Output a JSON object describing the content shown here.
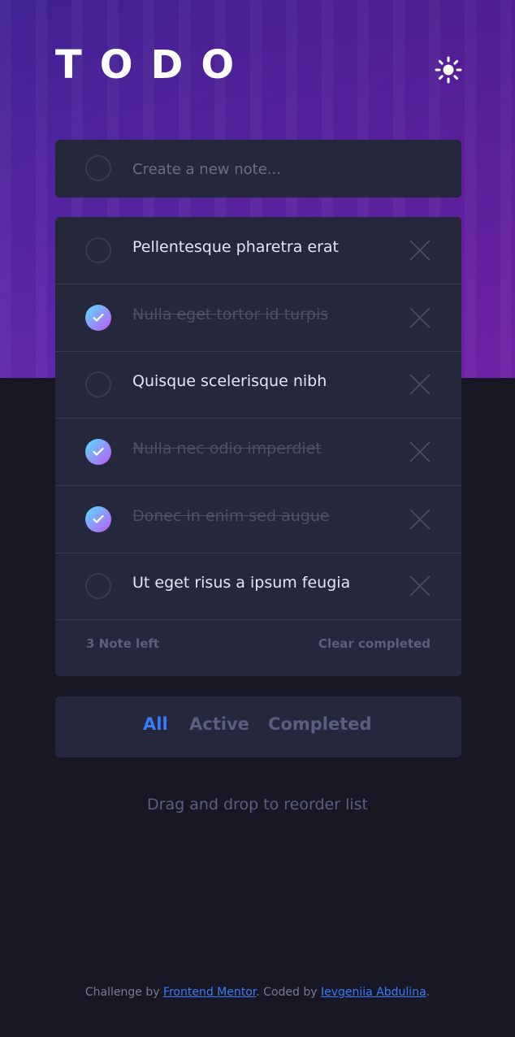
{
  "header": {
    "title": "TODO",
    "theme_icon": "sun-icon"
  },
  "new_note": {
    "placeholder": "Create a new note..."
  },
  "todos": [
    {
      "text": "Pellentesque pharetra erat",
      "completed": false
    },
    {
      "text": "Nulla eget tortor id turpis",
      "completed": true
    },
    {
      "text": "Quisque scelerisque nibh",
      "completed": false
    },
    {
      "text": "Nulla nec odio imperdiet",
      "completed": true
    },
    {
      "text": "Donec in enim sed augue",
      "completed": true
    },
    {
      "text": "Ut eget risus a ipsum feugia",
      "completed": false
    }
  ],
  "list_footer": {
    "items_left": "3 Note left",
    "clear_label": "Clear completed"
  },
  "filters": {
    "all": "All",
    "active": "Active",
    "completed": "Completed",
    "selected": "All"
  },
  "hint": "Drag and drop to reorder list",
  "attribution": {
    "prefix": "Challenge by ",
    "link1": "Frontend Mentor",
    "middle": ". Coded by ",
    "link2": "Ievgeniia Abdulina",
    "suffix": "."
  },
  "colors": {
    "accent": "#3a7bfd",
    "check_start": "#57ddff",
    "check_end": "#c058f3",
    "background": "#181824",
    "card": "#25273c"
  }
}
